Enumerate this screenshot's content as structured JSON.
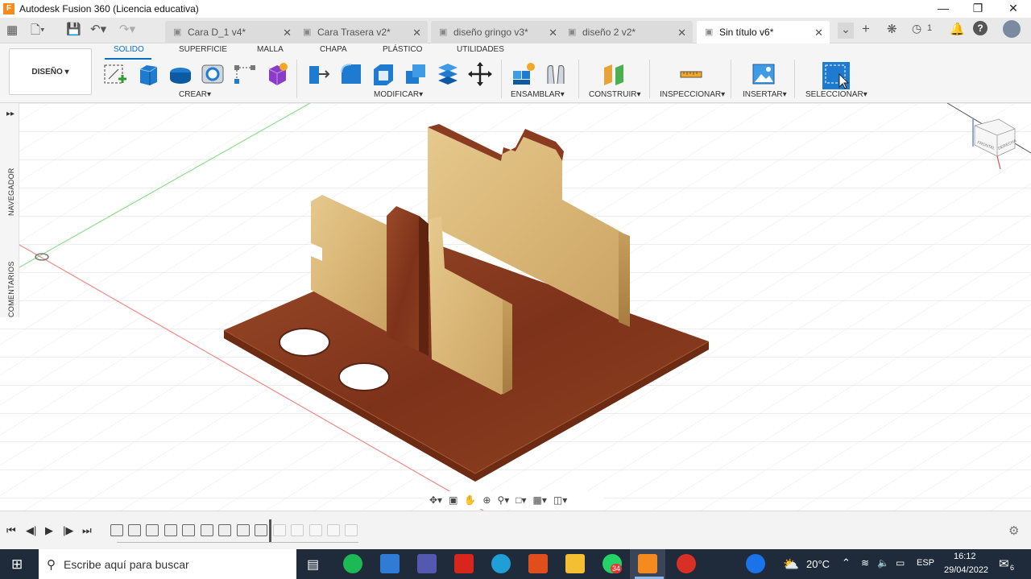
{
  "window": {
    "title": "Autodesk Fusion 360 (Licencia educativa)",
    "logo_letter": "F"
  },
  "tabs": [
    {
      "label": "Cara D_1 v4*",
      "active": false
    },
    {
      "label": "Cara Trasera v2*",
      "active": false
    },
    {
      "label": "diseño gringo v3*",
      "active": false
    },
    {
      "label": "diseño 2 v2*",
      "active": false
    },
    {
      "label": "Sin título v6*",
      "active": true
    }
  ],
  "header": {
    "jobs_count": "1"
  },
  "ribbon": {
    "workspace": "DISEÑO",
    "tabs": [
      "SOLIDO",
      "SUPERFICIE",
      "MALLA",
      "CHAPA",
      "PLÁSTICO",
      "UTILIDADES"
    ],
    "groups": [
      "CREAR",
      "MODIFICAR",
      "ENSAMBLAR",
      "CONSTRUIR",
      "INSPECCIONAR",
      "INSERTAR",
      "SELECCIONAR"
    ]
  },
  "side": {
    "navigator": "NAVEGADOR",
    "comments": "COMENTARIOS"
  },
  "viewcube": {
    "front": "FRONTAL",
    "right": "DERECHA"
  },
  "taskbar": {
    "search_placeholder": "Escribe aquí para buscar",
    "temperature": "20°C",
    "language": "ESP",
    "time": "16:12",
    "date": "29/04/2022",
    "whatsapp_badge": "34",
    "notification_count": "6"
  },
  "colors": {
    "accent": "#0a6fc2",
    "taskbar": "#1f2a3a",
    "wood_dark": "#8a3c20",
    "wood_light": "#e2c184"
  }
}
